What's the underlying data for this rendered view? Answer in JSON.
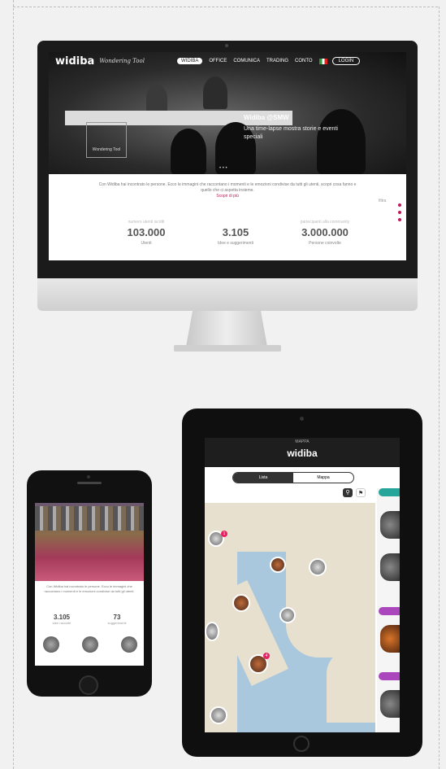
{
  "desktop": {
    "nav": {
      "logo": "widiba",
      "tagline": "Wondering Tool",
      "items": [
        "WIDIBA",
        "OFFICE",
        "COMUNICA",
        "TRADING",
        "CONTO"
      ],
      "login": "LOGIN"
    },
    "hero": {
      "title": "Widiba @SMW",
      "subtitle": "Una time-lapse mostra storie e eventi speciali",
      "badge": "Wondering Tool",
      "pager": "• • •"
    },
    "intro": {
      "text": "Con Widiba hai incontrato le persone. Ecco le immagini che raccontano i momenti e le emozioni condivise da tutti gli utenti, scopri cosa fanno e quello che ci aspetta insieme.",
      "link": "Scopri di più"
    },
    "side_label": "filtra",
    "stats": [
      {
        "label": "numero utenti iscritti",
        "value": "103.000",
        "caption": "Utenti"
      },
      {
        "label": "",
        "value": "3.105",
        "caption": "Idee e suggerimenti"
      },
      {
        "label": "partecipanti alla community",
        "value": "3.000.000",
        "caption": "Persone coinvolte"
      }
    ]
  },
  "phone": {
    "text": "Con Widiba hai incontrato le persone. Ecco le immagini che raccontano i momenti e le emozioni condivise da tutti gli utenti.",
    "stats": [
      {
        "value": "3.105",
        "caption": "idee raccolte"
      },
      {
        "value": "73",
        "caption": "suggerimenti"
      }
    ]
  },
  "tablet": {
    "top_small": "MAPPA",
    "brand": "widiba",
    "toggle": [
      "Lista",
      "Mappa"
    ],
    "tools": [
      "pin-icon",
      "filter-icon"
    ]
  },
  "colors": {
    "accent": "#c2185b",
    "dark": "#1b1b1b"
  }
}
